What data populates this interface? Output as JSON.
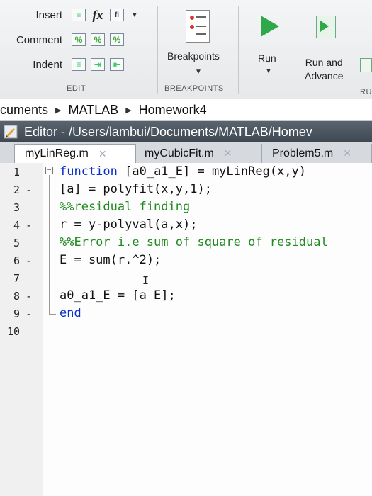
{
  "toolstrip": {
    "edit_section": {
      "rows": [
        {
          "label": "Insert",
          "icons": [
            "insert-section-icon",
            "fx-function-icon",
            "function-file-icon"
          ]
        },
        {
          "label": "Comment",
          "icons": [
            "comment-percent-icon",
            "uncomment-icon",
            "wrap-comments-icon"
          ]
        },
        {
          "label": "Indent",
          "icons": [
            "smart-indent-icon",
            "increase-indent-icon",
            "decrease-indent-icon"
          ]
        }
      ],
      "fx_text": "fx",
      "section_label": "EDIT"
    },
    "breakpoints": {
      "label": "Breakpoints",
      "section_label": "BREAKPOINTS"
    },
    "run": {
      "label": "Run"
    },
    "run_and_advance": {
      "label_line1": "Run and",
      "label_line2": "Advance"
    },
    "run_section_label": "RU"
  },
  "breadcrumb": {
    "items": [
      "cuments",
      "MATLAB",
      "Homework4"
    ]
  },
  "editor": {
    "title": "Editor - /Users/lambui/Documents/MATLAB/Homev",
    "tabs": [
      {
        "label": "myLinReg.m",
        "active": true
      },
      {
        "label": "myCubicFit.m",
        "active": false
      },
      {
        "label": "Problem5.m",
        "active": false
      }
    ],
    "lines": [
      {
        "num": "1",
        "bp": "",
        "text_kw": "function",
        "text": " [a0_a1_E] = myLinReg(x,y)"
      },
      {
        "num": "2",
        "bp": "-",
        "text": "[a] = polyfit(x,y,1);"
      },
      {
        "num": "3",
        "bp": "",
        "text_cm": "%%residual finding"
      },
      {
        "num": "4",
        "bp": "-",
        "text": "r = y-polyval(a,x);"
      },
      {
        "num": "5",
        "bp": "",
        "text_cm": "%%Error i.e sum of square of residual"
      },
      {
        "num": "6",
        "bp": "-",
        "text": "E = sum(r.^2);"
      },
      {
        "num": "7",
        "bp": "",
        "text": ""
      },
      {
        "num": "8",
        "bp": "-",
        "text": "a0_a1_E = [a E];"
      },
      {
        "num": "9",
        "bp": "-",
        "text_kw": "end"
      },
      {
        "num": "10",
        "bp": "",
        "text": ""
      }
    ]
  }
}
